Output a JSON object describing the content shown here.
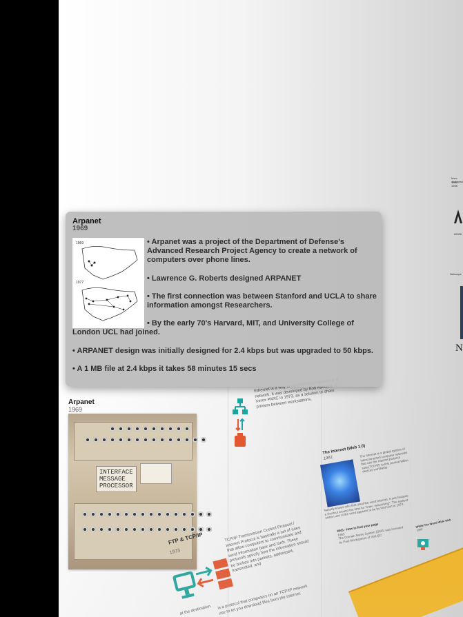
{
  "popup": {
    "title": "Arpanet",
    "year": "1969",
    "map_labels": [
      "1969",
      "1977"
    ],
    "paragraphs": [
      "• Arpanet was a project of the Department of Defense's Advanced Research Project Agency to create a network of computers over phone lines.",
      "• Lawrence G. Roberts designed ARPANET",
      "• The first connection was between Stanford and UCLA to share information amongst Researchers.",
      "• By the early 70's Harvard, MIT, and University College of London UCL had joined.",
      "• ARPANET design was initially designed for 2.4 kbps but was upgraded to 50 kbps.",
      "• A 1 MB file at 2.4 kbps it takes 58 minutes 15 secs"
    ]
  },
  "timeline": {
    "arpanet": {
      "title": "Arpanet",
      "year": "1969",
      "plate_text": "INTERFACE\nMESSAGE\nPROCESSOR"
    },
    "ftp": {
      "title": "FTP & TCP/IP",
      "year": "1973"
    },
    "ethernet_text": "Ethernet is a way to connect to computers in a network. It was developed by Bob Metcalfe at Xerox PARC in 1973, as a solution to share printers between workstations.",
    "tcpip_text": "TCP/IP Transmission Control Protocol / Internet Protocol is basically a set of rules that allow computers to communicate and send information back and forth. These protocols specify how the information should be broken into packets, addressed, transmitted, and",
    "destination_text": "at the destination.",
    "ftp_text": "is a protocol that computers on an TCP/IP network use to let you download files from the internet.",
    "internet": {
      "title": "The Internet (Web 1.0)",
      "year": "1982"
    },
    "internet_text": "The Internet is a global system of interconnected computer networks that use the Internet protocol suite(TCP/IP) to link several billion devices worldwide.",
    "internet_text2": "Nobody knows who first used the word Internet. It just became a shortcut around the time for \"inter- networking\". The earliest written use of the word appears to be by Vint Cerf in 1974.",
    "dns": {
      "title": "DNS - How to find your page",
      "year": "1983"
    },
    "dns_text": "The Domain Name System (DNS) was invented by Paul Mockapetris of ISI/USC",
    "www": {
      "title": "WWW The World Wide Web",
      "year": "1990"
    },
    "edge_labels": [
      "Marc Andreesen",
      "1994 - 1998",
      "#5926",
      "Netscape"
    ]
  },
  "colors": {
    "popup_bg": "#bababa",
    "timeline_bar": "#f4b41c",
    "icon_orange": "#e4532b",
    "icon_teal": "#18a39a"
  }
}
